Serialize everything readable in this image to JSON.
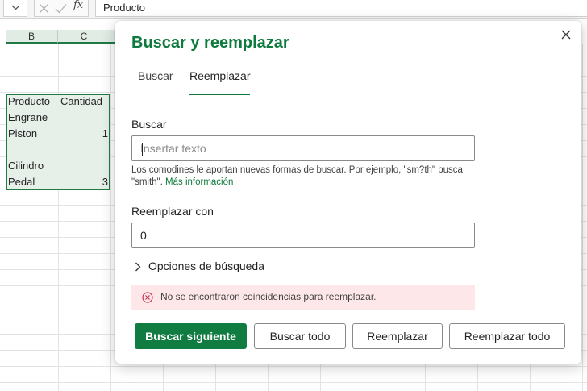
{
  "formula_bar": {
    "content": "Producto",
    "dropdown_icon": "chevron-down-icon",
    "cancel_icon": "x-icon",
    "confirm_icon": "check-icon",
    "function_label": "fx"
  },
  "grid": {
    "columns": [
      "B",
      "C"
    ],
    "rows": [
      {
        "b": "Producto",
        "c": "Cantidad"
      },
      {
        "b": "Engrane",
        "c": ""
      },
      {
        "b": "Piston",
        "c": "1"
      },
      {
        "b": "",
        "c": ""
      },
      {
        "b": "Cilindro",
        "c": ""
      },
      {
        "b": "Pedal",
        "c": "3"
      }
    ]
  },
  "dialog": {
    "title": "Buscar y reemplazar",
    "tabs": [
      {
        "label": "Buscar",
        "active": false
      },
      {
        "label": "Reemplazar",
        "active": true
      }
    ],
    "find": {
      "label": "Buscar",
      "value": "",
      "placeholder": "Insertar texto"
    },
    "help": {
      "text": "Los comodines le aportan nuevas formas de buscar. Por ejemplo, \"sm?th\" busca \"smith\". ",
      "link": "Más información"
    },
    "replace": {
      "label": "Reemplazar con",
      "value": "0"
    },
    "options_label": "Opciones de búsqueda",
    "error_message": "No se encontraron coincidencias para reemplazar.",
    "buttons": {
      "find_next": "Buscar siguiente",
      "find_all": "Buscar todo",
      "replace": "Reemplazar",
      "replace_all": "Reemplazar todo"
    }
  },
  "colors": {
    "accent": "#107c41",
    "title": "#0e7a3d",
    "error_bg": "#fde7e9",
    "error_icon": "#c4314b"
  }
}
